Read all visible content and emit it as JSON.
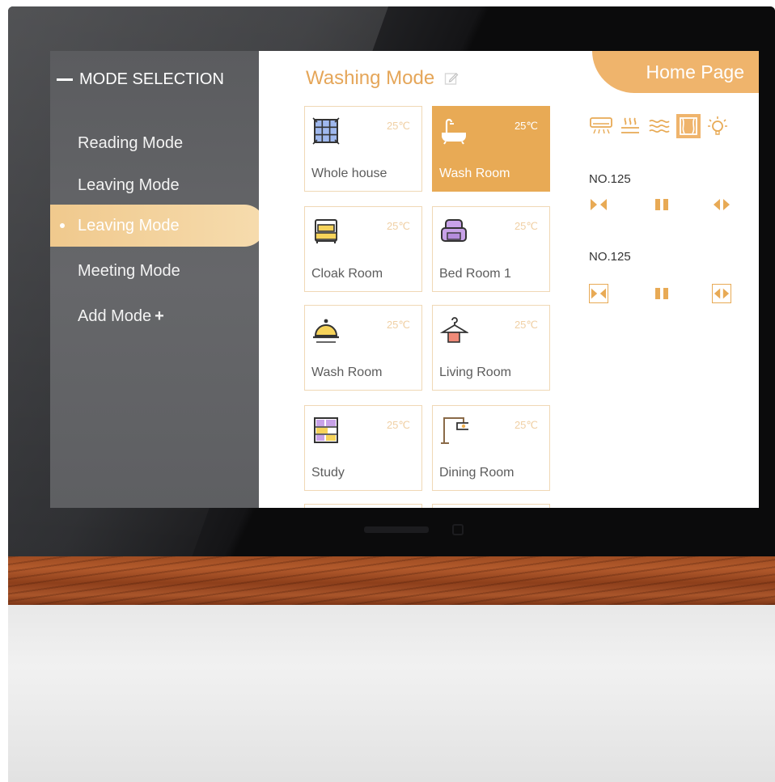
{
  "sidebar": {
    "header": "MODE SELECTION",
    "items": [
      {
        "label": "Reading Mode",
        "active": false
      },
      {
        "label": "Leaving Mode",
        "active": false
      },
      {
        "label": "Leaving Mode",
        "active": true
      },
      {
        "label": "Meeting Mode",
        "active": false
      },
      {
        "label": "Add Mode",
        "suffix": "+"
      }
    ]
  },
  "main": {
    "title": "Washing Mode",
    "home_tab": "Home Page",
    "rooms": [
      {
        "name": "Whole house",
        "temp": "25℃",
        "icon": "grid-window-icon",
        "selected": false
      },
      {
        "name": "Wash Room",
        "temp": "25℃",
        "icon": "bathtub-icon",
        "selected": true
      },
      {
        "name": "Cloak Room",
        "temp": "25℃",
        "icon": "bed-icon",
        "selected": false
      },
      {
        "name": "Bed Room 1",
        "temp": "25℃",
        "icon": "armchair-icon",
        "selected": false
      },
      {
        "name": "Wash Room",
        "temp": "25℃",
        "icon": "bell-cover-icon",
        "selected": false
      },
      {
        "name": "Living Room",
        "temp": "25℃",
        "icon": "hanger-icon",
        "selected": false
      },
      {
        "name": "Study",
        "temp": "25℃",
        "icon": "bookshelf-icon",
        "selected": false
      },
      {
        "name": "Dining Room",
        "temp": "25℃",
        "icon": "pendant-lamp-icon",
        "selected": false
      }
    ],
    "device_icons": [
      "air-conditioner-icon",
      "floor-heating-icon",
      "ventilation-icon",
      "curtain-icon",
      "light-bulb-icon"
    ],
    "curtains": [
      {
        "label": "NO.125"
      },
      {
        "label": "NO.125"
      }
    ]
  },
  "colors": {
    "accent": "#e8aa55",
    "accent_light": "#efb46c",
    "sidebar_bg": "#606164"
  }
}
